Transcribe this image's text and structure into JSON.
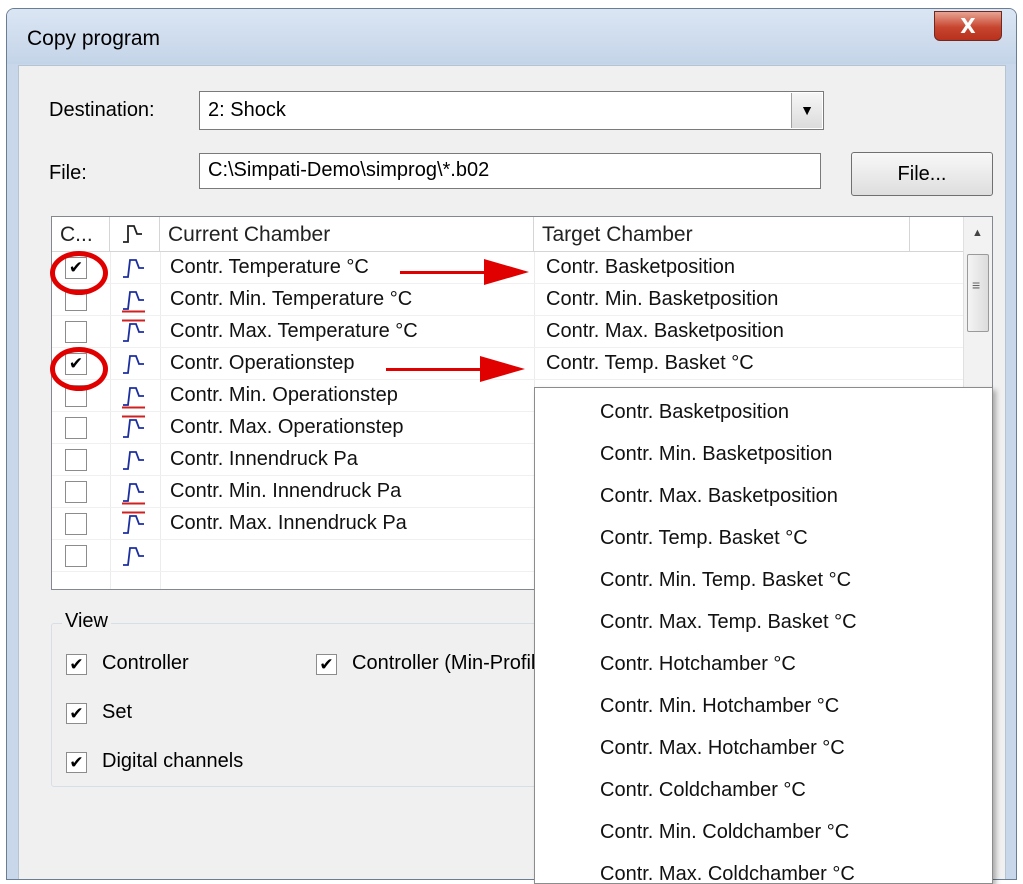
{
  "window": {
    "title": "Copy program",
    "close_glyph": "X"
  },
  "destination": {
    "label": "Destination:",
    "value": "2: Shock"
  },
  "file": {
    "label": "File:",
    "value": "C:\\Simpati-Demo\\simprog\\*.b02",
    "button_label": "File..."
  },
  "grid": {
    "headers": {
      "check": "C...",
      "icon": "▏┐",
      "current": "Current Chamber",
      "target": "Target Chamber"
    },
    "rows": [
      {
        "checked": true,
        "current": "Contr. Temperature °C",
        "target": "Contr. Basketposition"
      },
      {
        "checked": false,
        "current": "Contr. Min. Temperature °C",
        "target": "Contr. Min. Basketposition"
      },
      {
        "checked": false,
        "current": "Contr. Max. Temperature °C",
        "target": "Contr. Max. Basketposition"
      },
      {
        "checked": true,
        "current": "Contr. Operationstep",
        "target": "Contr. Temp. Basket °C"
      },
      {
        "checked": false,
        "current": "Contr. Min. Operationstep",
        "target": ""
      },
      {
        "checked": false,
        "current": "Contr. Max. Operationstep",
        "target": ""
      },
      {
        "checked": false,
        "current": "Contr. Innendruck Pa",
        "target": ""
      },
      {
        "checked": false,
        "current": "Contr. Min. Innendruck Pa",
        "target": ""
      },
      {
        "checked": false,
        "current": "Contr. Max. Innendruck Pa",
        "target": ""
      },
      {
        "checked": false,
        "current": "",
        "target": ""
      }
    ]
  },
  "view": {
    "title": "View",
    "options": [
      {
        "label": "Controller",
        "checked": true
      },
      {
        "label": "Controller (Min-Profile",
        "checked": true
      },
      {
        "label": "Set",
        "checked": true
      },
      {
        "label": "Digital channels",
        "checked": true
      }
    ]
  },
  "dropdown": {
    "items": [
      "Contr. Basketposition",
      "Contr. Min. Basketposition",
      "Contr. Max. Basketposition",
      "Contr. Temp. Basket °C",
      "Contr. Min. Temp. Basket °C",
      "Contr. Max. Temp. Basket °C",
      "Contr. Hotchamber °C",
      "Contr. Min. Hotchamber °C",
      "Contr. Max. Hotchamber °C",
      "Contr. Coldchamber °C",
      "Contr. Min. Coldchamber °C",
      "Contr. Max. Coldchamber °C"
    ]
  },
  "colors": {
    "annotation": "#e00000",
    "profile_icon": "#1c2fa0",
    "limit_line": "#d02020"
  },
  "icons": {
    "check": "✔",
    "dropdown_arrow": "▼",
    "scroll_up": "▲",
    "scroll_grip": "≡"
  }
}
